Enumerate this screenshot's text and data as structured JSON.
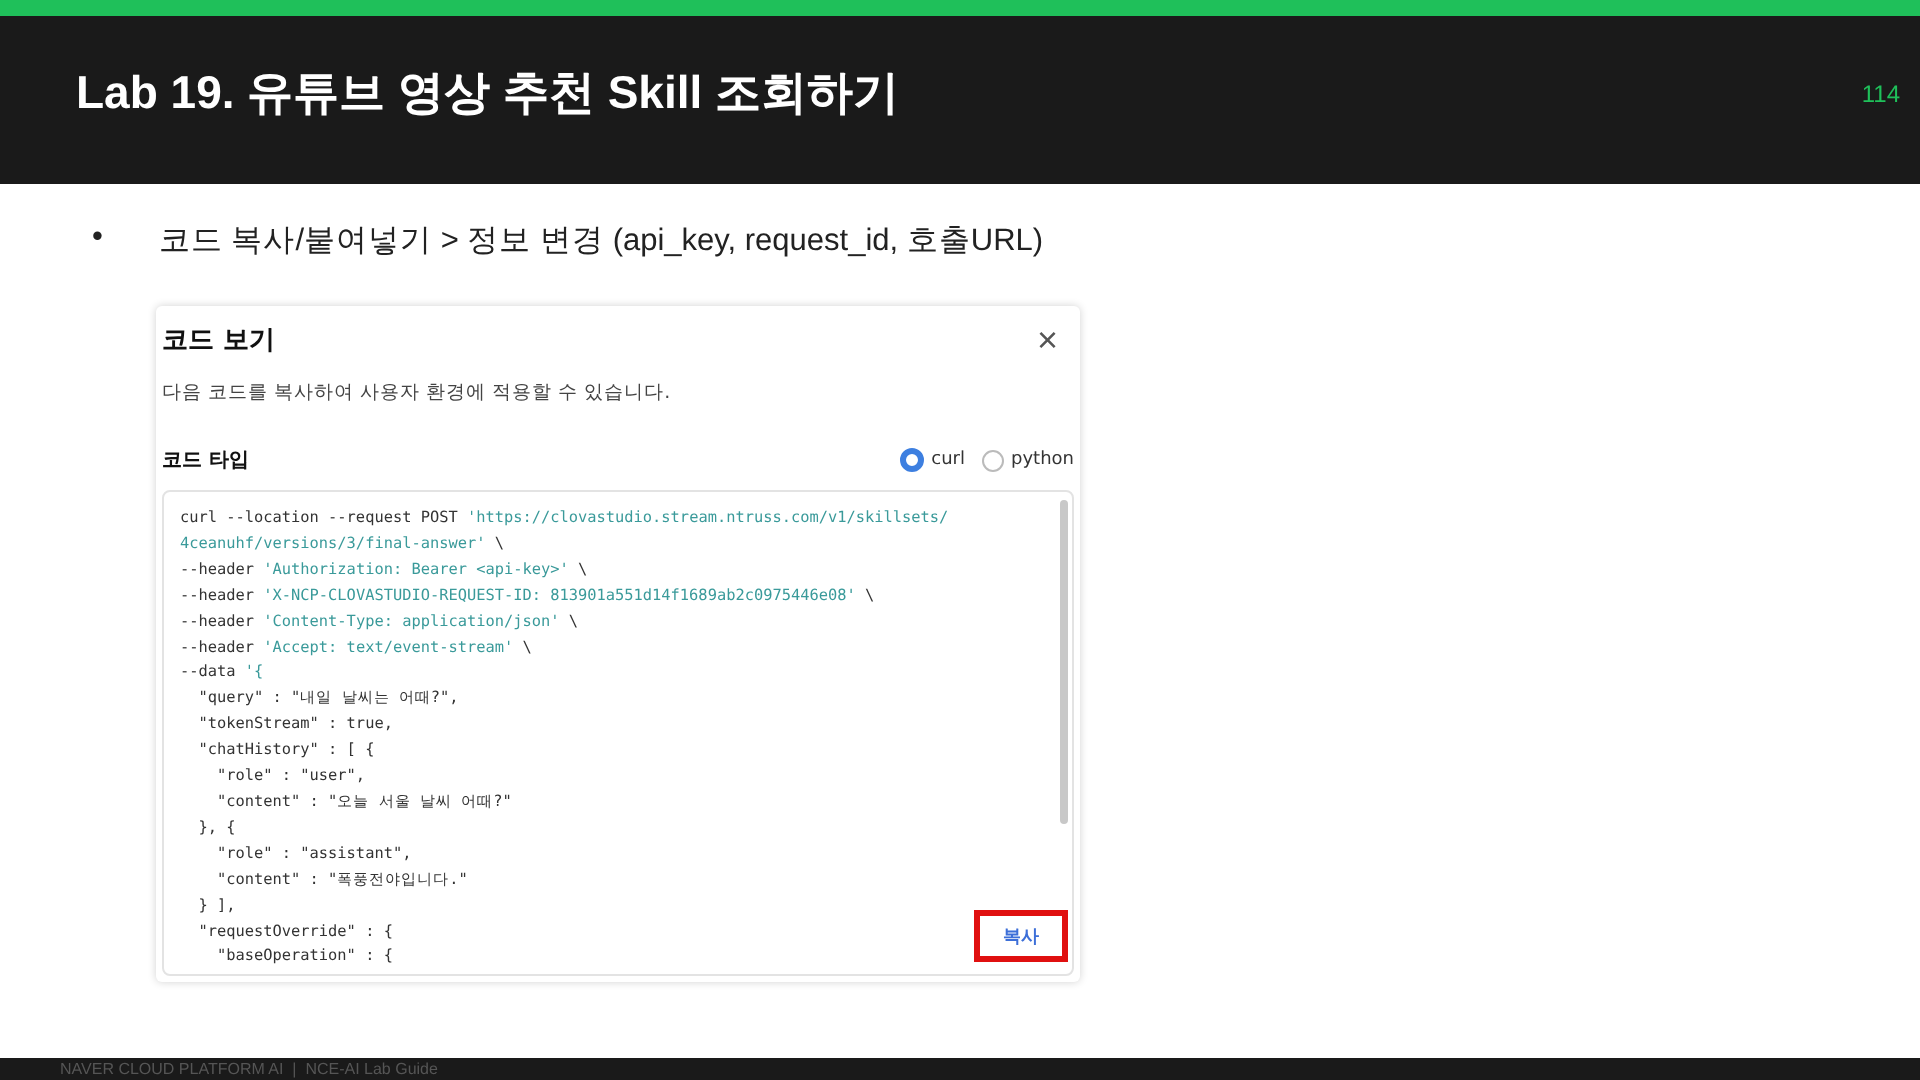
{
  "slide": {
    "title": "Lab 19. 유튜브 영상 추천 Skill 조회하기",
    "page_number": "114",
    "bullets": [
      {
        "marker": "•",
        "text": "코드 복사/붙여넣기 > 정보 변경 (api_key, request_id, 호출URL)"
      }
    ],
    "footer": "NAVER CLOUD PLATFORM AI  |  NCE-AI Lab Guide"
  },
  "dialog": {
    "title": "코드 보기",
    "close_glyph": "×",
    "description": "다음 코드를 복사하여 사용자 환경에 적용할 수 있습니다.",
    "code_type_label": "코드 타입",
    "code_types": [
      {
        "label": "curl",
        "selected": true
      },
      {
        "label": "python",
        "selected": false
      }
    ],
    "code_lines": [
      [
        {
          "kind": "plain",
          "text": "curl --location --request POST "
        },
        {
          "kind": "string",
          "text": "'https://clovastudio.stream.ntruss.com/v1/skillsets/"
        }
      ],
      [
        {
          "kind": "string",
          "text": "4ceanuhf/versions/3/final-answer'"
        },
        {
          "kind": "plain",
          "text": " \\"
        }
      ],
      [
        {
          "kind": "plain",
          "text": "--header "
        },
        {
          "kind": "string",
          "text": "'Authorization: Bearer <api-key>'"
        },
        {
          "kind": "plain",
          "text": " \\"
        }
      ],
      [
        {
          "kind": "plain",
          "text": "--header "
        },
        {
          "kind": "string",
          "text": "'X-NCP-CLOVASTUDIO-REQUEST-ID: 813901a551d14f1689ab2c0975446e08'"
        },
        {
          "kind": "plain",
          "text": " \\"
        }
      ],
      [
        {
          "kind": "plain",
          "text": "--header "
        },
        {
          "kind": "string",
          "text": "'Content-Type: application/json'"
        },
        {
          "kind": "plain",
          "text": " \\"
        }
      ],
      [
        {
          "kind": "plain",
          "text": "--header "
        },
        {
          "kind": "string",
          "text": "'Accept: text/event-stream'"
        },
        {
          "kind": "plain",
          "text": " \\"
        }
      ],
      [
        {
          "kind": "plain",
          "text": "--data "
        },
        {
          "kind": "string",
          "text": "'{"
        }
      ],
      [
        {
          "kind": "plain",
          "text": "  \"query\" : \"내일 날씨는 어때?\","
        }
      ],
      [
        {
          "kind": "plain",
          "text": "  \"tokenStream\" : true,"
        }
      ],
      [
        {
          "kind": "plain",
          "text": "  \"chatHistory\" : [ {"
        }
      ],
      [
        {
          "kind": "plain",
          "text": "    \"role\" : \"user\","
        }
      ],
      [
        {
          "kind": "plain",
          "text": "    \"content\" : \"오늘 서울 날씨 어때?\""
        }
      ],
      [
        {
          "kind": "plain",
          "text": "  }, {"
        }
      ],
      [
        {
          "kind": "plain",
          "text": "    \"role\" : \"assistant\","
        }
      ],
      [
        {
          "kind": "plain",
          "text": "    \"content\" : \"폭풍전야입니다.\""
        }
      ],
      [
        {
          "kind": "plain",
          "text": "  } ],"
        }
      ],
      [
        {
          "kind": "plain",
          "text": "  \"requestOverride\" : {"
        }
      ],
      [
        {
          "kind": "plain",
          "text": "    \"baseOperation\" : {"
        }
      ]
    ],
    "copy_button": {
      "label": "복사",
      "highlighted": true
    }
  }
}
